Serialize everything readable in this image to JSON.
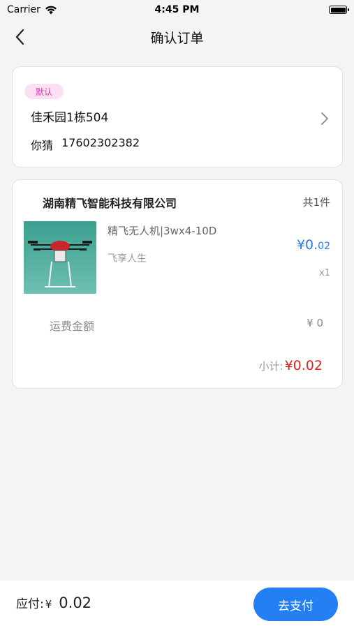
{
  "status_bar": {
    "carrier": "Carrier",
    "time": "4:45 PM"
  },
  "nav": {
    "title": "确认订单"
  },
  "address": {
    "badge": "默认",
    "line": "佳禾园1栋504",
    "name": "你猜",
    "phone": "17602302382"
  },
  "order": {
    "shop_name": "湖南精飞智能科技有限公司",
    "item_count": "共1件",
    "product": {
      "name": "精飞无人机|3wx4-10D",
      "subtitle": "飞享人生",
      "price_main": "¥0.",
      "price_decimal": "02",
      "quantity": "x1"
    },
    "shipping_label": "运费金额",
    "shipping_value": "¥ 0",
    "subtotal_label": "小计:",
    "subtotal_value": "¥0.02"
  },
  "footer": {
    "pay_label": "应付:",
    "currency": "¥",
    "amount": "0.02",
    "pay_button": "去支付"
  },
  "colors": {
    "accent": "#2480f2",
    "price_blue": "#2b7ae8",
    "subtotal_red": "#e0211f",
    "badge_bg": "#fbe0f4",
    "badge_text": "#d23ca8"
  }
}
